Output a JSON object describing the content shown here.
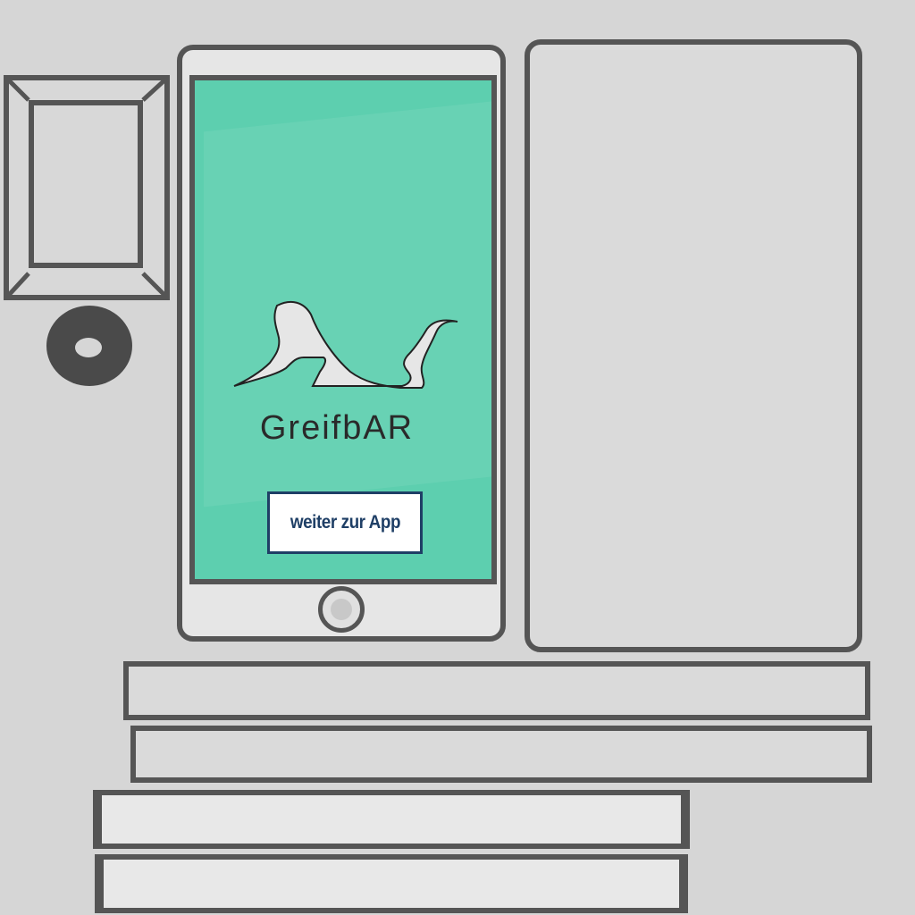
{
  "app": {
    "brand_name": "GreifbAR",
    "cta_label": "weiter zur App",
    "logo_icon": "griffin-icon"
  },
  "colors": {
    "screen_background": "#5dcfaf",
    "cta_border": "#1f3f66",
    "cta_text": "#1f3f66",
    "sketch_lines": "#555555",
    "background": "#d6d6d6"
  }
}
